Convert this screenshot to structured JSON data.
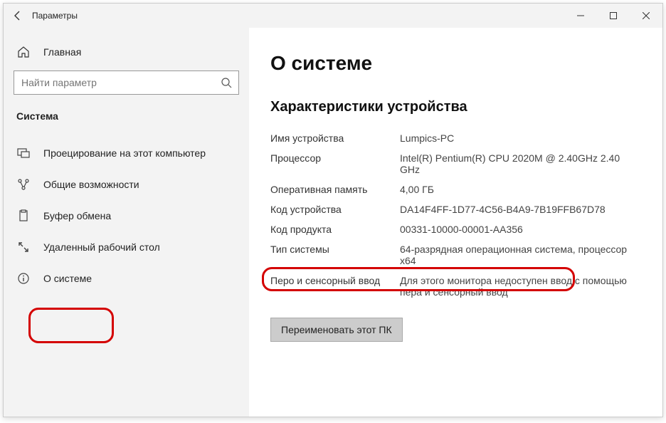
{
  "titlebar": {
    "title": "Параметры"
  },
  "sidebar": {
    "home": "Главная",
    "search_placeholder": "Найти параметр",
    "category": "Система",
    "items": [
      {
        "label": "Проецирование на этот компьютер"
      },
      {
        "label": "Общие возможности"
      },
      {
        "label": "Буфер обмена"
      },
      {
        "label": "Удаленный рабочий стол"
      },
      {
        "label": "О системе"
      }
    ]
  },
  "main": {
    "heading": "О системе",
    "section": "Характеристики устройства",
    "specs": [
      {
        "label": "Имя устройства",
        "value": "Lumpics-PC"
      },
      {
        "label": "Процессор",
        "value": "Intel(R) Pentium(R) CPU 2020M @ 2.40GHz 2.40 GHz"
      },
      {
        "label": "Оперативная память",
        "value": "4,00 ГБ"
      },
      {
        "label": "Код устройства",
        "value": "DA14F4FF-1D77-4C56-B4A9-7B19FFB67D78"
      },
      {
        "label": "Код продукта",
        "value": "00331-10000-00001-AA356"
      },
      {
        "label": "Тип системы",
        "value": "64-разрядная операционная система, процессор x64"
      },
      {
        "label": "Перо и сенсорный ввод",
        "value": "Для этого монитора недоступен ввод с помощью пера и сенсорный ввод"
      }
    ],
    "rename_button": "Переименовать этот ПК"
  }
}
